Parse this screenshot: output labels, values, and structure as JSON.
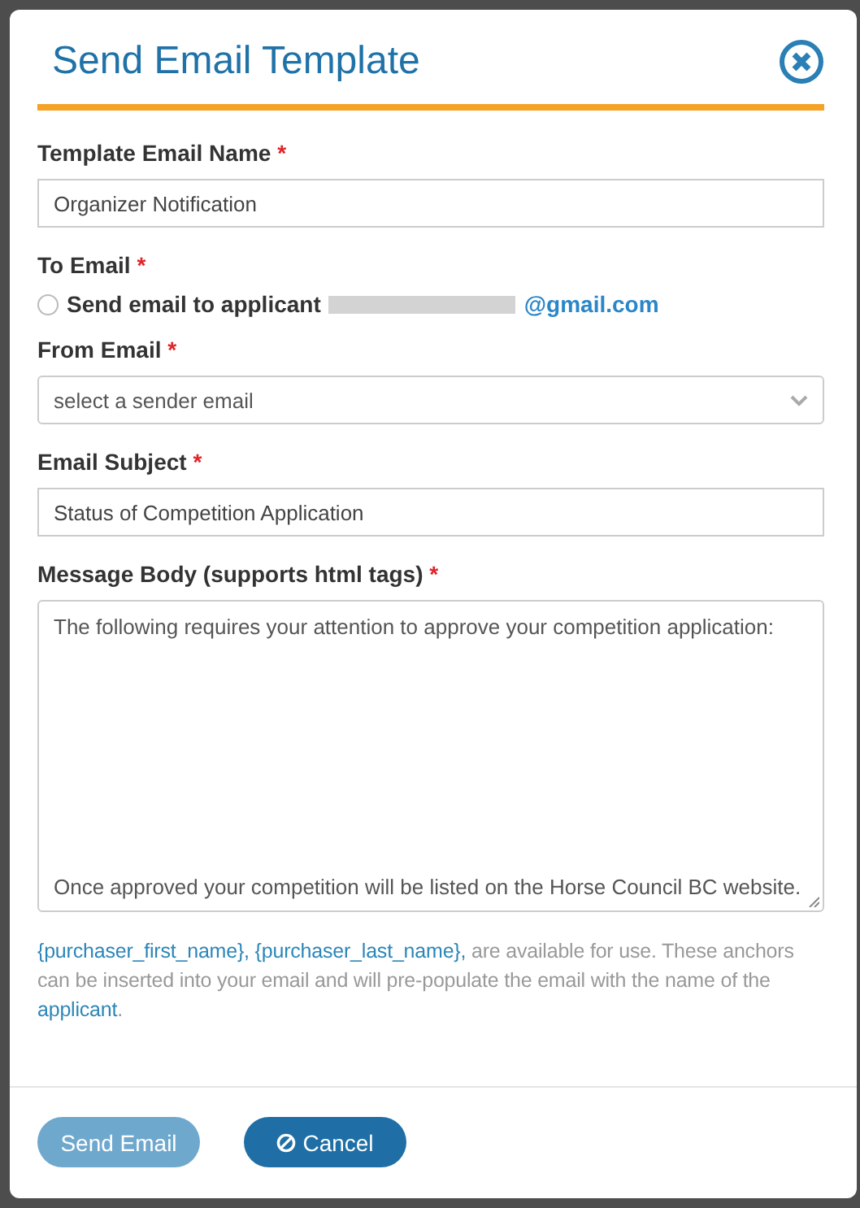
{
  "dialog": {
    "title": "Send Email Template"
  },
  "fields": [
    {
      "kind": "text",
      "label": "Template Email Name",
      "required": true,
      "value": "Organizer Notification"
    },
    {
      "kind": "radio",
      "label": "To Email",
      "required": true,
      "option_label": "Send email to applicant",
      "email_visible": "@gmail.com",
      "selected": false
    },
    {
      "kind": "select",
      "label": "From Email",
      "required": true,
      "placeholder": "select a sender email"
    },
    {
      "kind": "text",
      "label": "Email Subject",
      "required": true,
      "value": "Status of Competition Application"
    },
    {
      "kind": "textarea",
      "label": "Message Body (supports html tags)",
      "required": true,
      "value": "The following requires your attention to approve your competition application:\n\n\n\n\n\n\n\n\n\nOnce approved your competition will be listed on the Horse Council BC website."
    }
  ],
  "help_text": [
    {
      "kind": "anchor",
      "text": "{purchaser_first_name}, {purchaser_last_name},"
    },
    {
      "kind": "plain",
      "text": " are available for use. These anchors can be inserted into your email and will pre-populate the email with the name of the "
    },
    {
      "kind": "anchor",
      "text": "applicant"
    },
    {
      "kind": "plain",
      "text": "."
    }
  ],
  "buttons": [
    {
      "kind": "primary",
      "label": "Send Email"
    },
    {
      "kind": "cancel",
      "label": "Cancel"
    }
  ],
  "required_mark": "*"
}
